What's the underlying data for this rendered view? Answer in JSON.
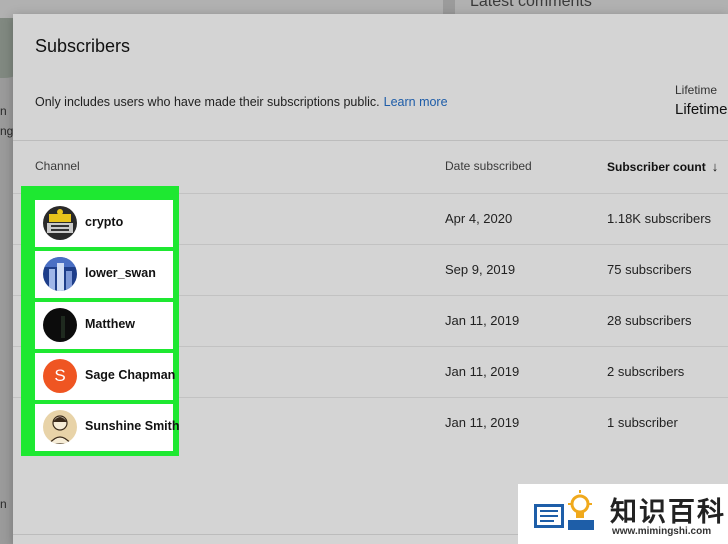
{
  "background": {
    "section_title": "Latest comments",
    "edge_letters": [
      "n",
      "ng",
      "n"
    ]
  },
  "dialog": {
    "title": "Subscribers",
    "description": "Only includes users who have made their subscriptions public.",
    "learn_more": "Learn more",
    "range_label": "Lifetime",
    "range_value": "Lifetime"
  },
  "table": {
    "columns": {
      "channel": "Channel",
      "date": "Date subscribed",
      "count": "Subscriber count",
      "sort_icon": "arrow-down-icon"
    },
    "rows": [
      {
        "channel": "crypto",
        "date": "Apr 4, 2020",
        "count": "1.18K subscribers",
        "avatar": "yellow-badge"
      },
      {
        "channel": "lower_swan",
        "date": "Sep 9, 2019",
        "count": "75 subscribers",
        "avatar": "city-photo"
      },
      {
        "channel": "Matthew",
        "date": "Jan 11, 2019",
        "count": "28 subscribers",
        "avatar": "dark"
      },
      {
        "channel": "Sage Chapman",
        "date": "Jan 11, 2019",
        "count": "2 subscribers",
        "avatar": "letter",
        "avatar_letter": "S"
      },
      {
        "channel": "Sunshine Smith",
        "date": "Jan 11, 2019",
        "count": "1 subscriber",
        "avatar": "sketch-portrait"
      }
    ]
  },
  "watermark": {
    "text_cn": "知识百科",
    "url": "www.mimingshi.com"
  },
  "colors": {
    "highlight": "#1ee831",
    "link": "#1d5ca8",
    "letter_avatar": "#ef5522"
  }
}
